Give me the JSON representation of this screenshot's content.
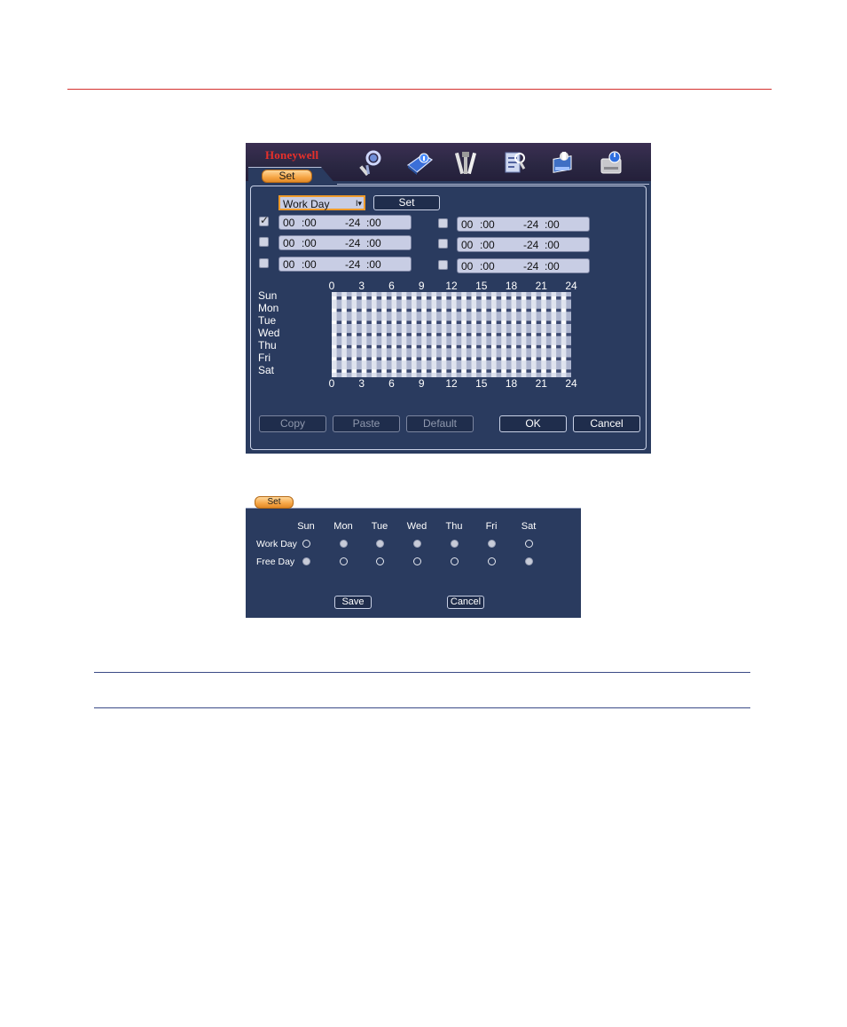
{
  "schedule_window": {
    "brand": "Honeywell",
    "tab_label": "Set",
    "toolbar_icons": [
      "search-icon",
      "info-icon",
      "tools-icon",
      "advanced-icon",
      "backup-icon",
      "shutdown-icon"
    ],
    "day_type": "Work Day",
    "set_button": "Set",
    "periods": [
      {
        "checked": true,
        "start_h": "00",
        "start_m": ":00",
        "end_h": "-24",
        "end_m": ":00"
      },
      {
        "checked": false,
        "start_h": "00",
        "start_m": ":00",
        "end_h": "-24",
        "end_m": ":00"
      },
      {
        "checked": false,
        "start_h": "00",
        "start_m": ":00",
        "end_h": "-24",
        "end_m": ":00"
      },
      {
        "checked": false,
        "start_h": "00",
        "start_m": ":00",
        "end_h": "-24",
        "end_m": ":00"
      },
      {
        "checked": false,
        "start_h": "00",
        "start_m": ":00",
        "end_h": "-24",
        "end_m": ":00"
      },
      {
        "checked": false,
        "start_h": "00",
        "start_m": ":00",
        "end_h": "-24",
        "end_m": ":00"
      }
    ],
    "hour_ticks": [
      "0",
      "3",
      "6",
      "9",
      "12",
      "15",
      "18",
      "21",
      "24"
    ],
    "days": [
      "Sun",
      "Mon",
      "Tue",
      "Wed",
      "Thu",
      "Fri",
      "Sat"
    ],
    "buttons": {
      "copy": "Copy",
      "paste": "Paste",
      "default": "Default",
      "ok": "OK",
      "cancel": "Cancel"
    },
    "colors": {
      "panel": "#2a3b5f",
      "accent": "#f6a545",
      "brand": "#e8302a"
    }
  },
  "day_setup_window": {
    "tab_label": "Set",
    "days": [
      "Sun",
      "Mon",
      "Tue",
      "Wed",
      "Thu",
      "Fri",
      "Sat"
    ],
    "rows": [
      {
        "label": "Work Day",
        "selected": [
          false,
          true,
          true,
          true,
          true,
          true,
          false
        ]
      },
      {
        "label": "Free Day",
        "selected": [
          true,
          false,
          false,
          false,
          false,
          false,
          true
        ]
      }
    ],
    "save_label": "Save",
    "cancel_label": "Cancel"
  }
}
